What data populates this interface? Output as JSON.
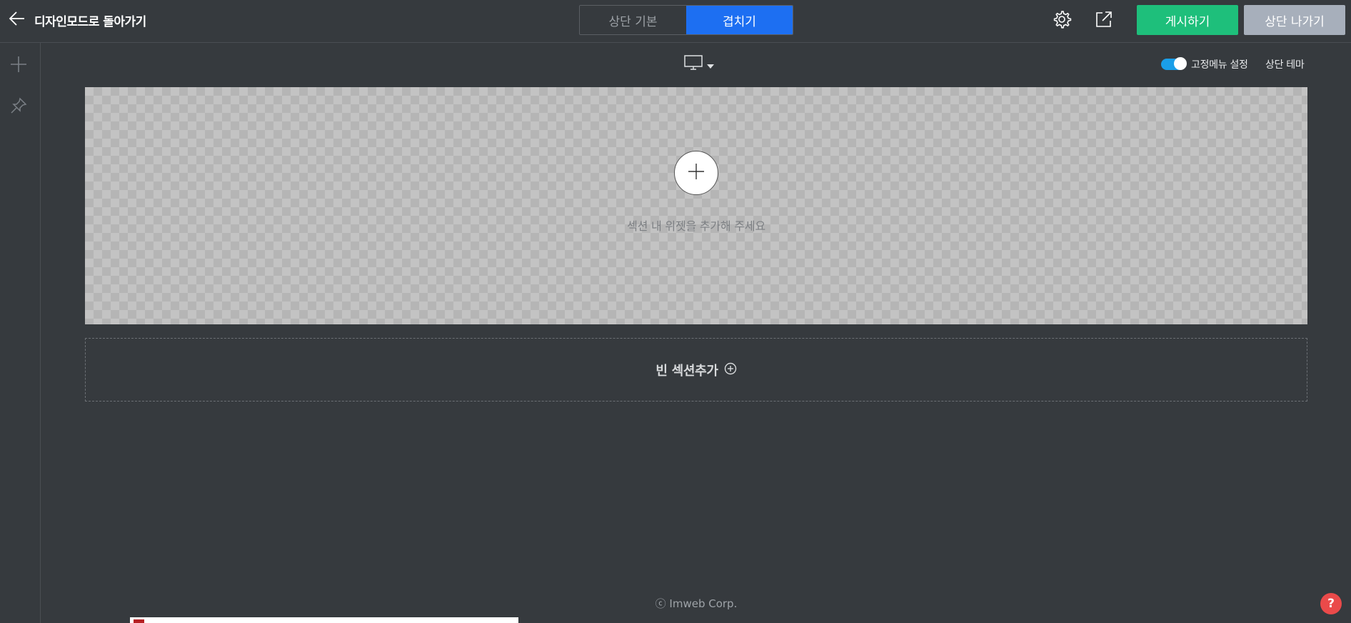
{
  "header": {
    "back_label": "디자인모드로 돌아가기",
    "mode_tabs": [
      {
        "label": "상단 기본",
        "active": false
      },
      {
        "label": "겹치기",
        "active": true
      }
    ],
    "settings_icon": "gear-icon",
    "external_icon": "external-link-icon",
    "publish_label": "게시하기",
    "exit_label": "상단 나가기"
  },
  "sidebar": {
    "items": [
      {
        "icon": "plus-icon"
      },
      {
        "icon": "pin-icon"
      }
    ]
  },
  "toolbar": {
    "device_icon": "desktop-icon",
    "fixed_menu_label": "고정메뉴 설정",
    "fixed_menu_enabled": true,
    "theme_label": "상단 테마"
  },
  "section": {
    "hint": "섹션 내 위젯을 추가해 주세요"
  },
  "add_section": {
    "label": "빈 섹션추가"
  },
  "footer": {
    "copyright": "ⓒ Imweb Corp."
  },
  "help": {
    "label": "?"
  },
  "colors": {
    "background": "#363a3e",
    "active_tab": "#1d6ff2",
    "publish": "#1ebf7b",
    "exit": "#a7afbb",
    "toggle": "#1a9ee8",
    "help": "#ea4a4a"
  }
}
